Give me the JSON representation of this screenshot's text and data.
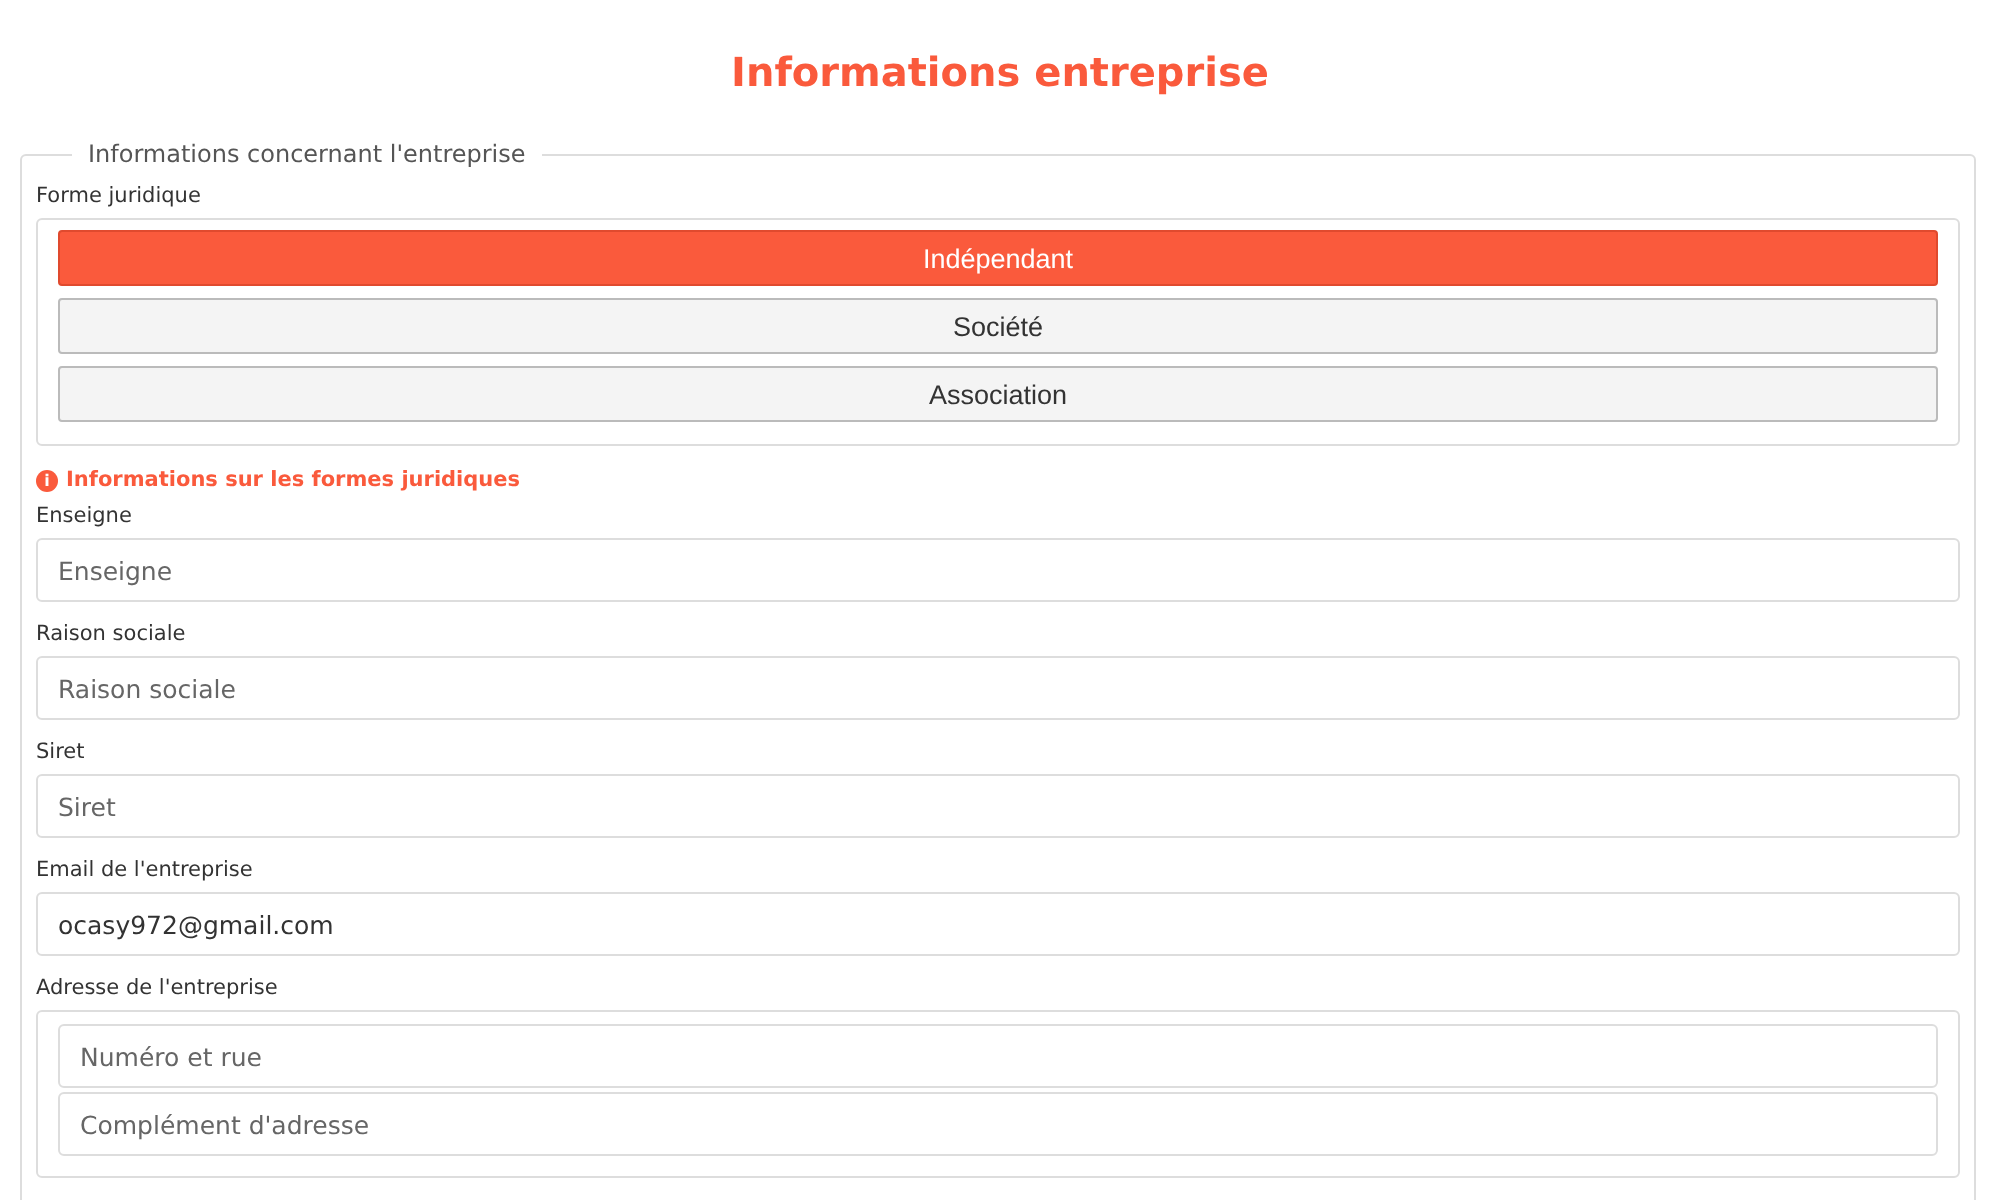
{
  "page_title": "Informations entreprise",
  "section": {
    "legend": "Informations concernant l'entreprise",
    "legal_form": {
      "label": "Forme juridique",
      "options": [
        {
          "label": "Indépendant",
          "selected": true
        },
        {
          "label": "Société",
          "selected": false
        },
        {
          "label": "Association",
          "selected": false
        }
      ]
    },
    "info_link": {
      "icon": "i",
      "text": "Informations sur les formes juridiques"
    },
    "fields": [
      {
        "kind": "input",
        "label": "Enseigne",
        "placeholder": "Enseigne"
      },
      {
        "kind": "input",
        "label": "Raison sociale",
        "placeholder": "Raison sociale"
      },
      {
        "kind": "input",
        "label": "Siret",
        "placeholder": "Siret"
      },
      {
        "kind": "input",
        "label": "Email de l'entreprise",
        "value": "ocasy972@gmail.com"
      },
      {
        "kind": "group",
        "label": "Adresse de l'entreprise",
        "inputs": [
          {
            "placeholder": "Numéro et rue"
          },
          {
            "placeholder": "Complément d'adresse"
          }
        ]
      }
    ]
  }
}
